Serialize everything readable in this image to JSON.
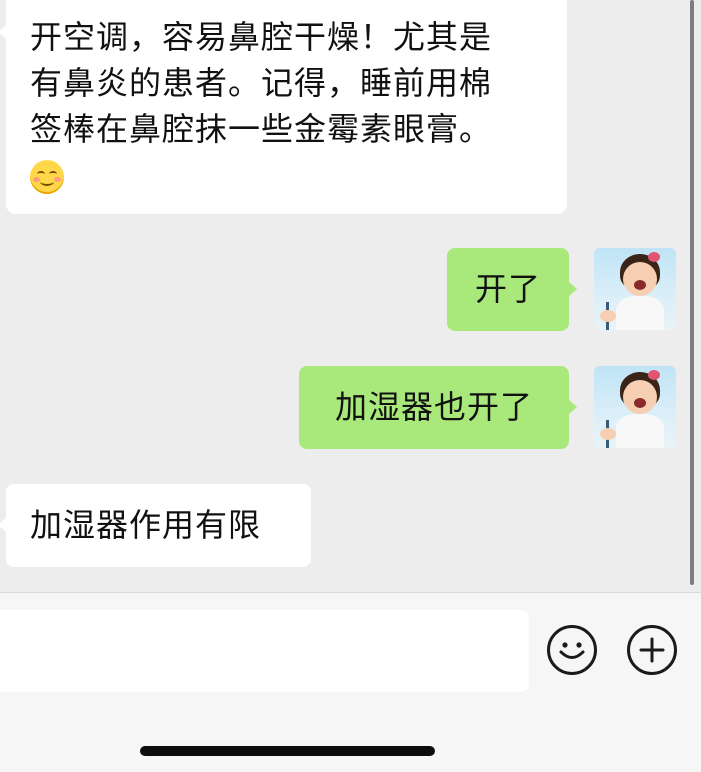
{
  "messages": [
    {
      "side": "incoming",
      "lines": [
        "开空调，容易鼻腔干燥！尤其是",
        "有鼻炎的患者。记得，睡前用棉",
        "签棒在鼻腔抹一些金霉素眼膏。"
      ],
      "emoji": "smiling-face-blush-icon"
    },
    {
      "side": "outgoing",
      "text": "开了"
    },
    {
      "side": "outgoing",
      "text": "加湿器也开了"
    },
    {
      "side": "incoming",
      "text": "加湿器作用有限"
    }
  ],
  "composer": {
    "value": "",
    "emoji_icon": "smiley-face-icon",
    "plus_icon": "plus-icon"
  },
  "colors": {
    "chat_background": "#ededed",
    "incoming_bubble": "#ffffff",
    "outgoing_bubble": "#a9e97b",
    "input_bar": "#f6f6f6"
  }
}
